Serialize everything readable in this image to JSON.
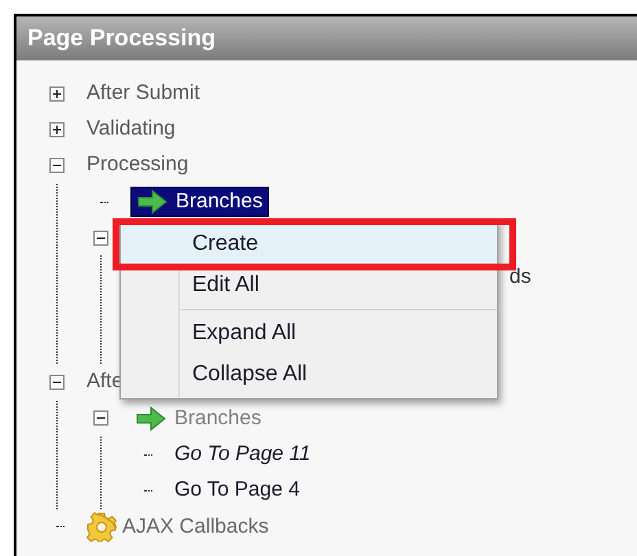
{
  "panel": {
    "title": "Page Processing"
  },
  "tree": [
    {
      "label": "After Submit",
      "expanded": false
    },
    {
      "label": "Validating",
      "expanded": false
    },
    {
      "label": "Processing",
      "expanded": true,
      "children": [
        {
          "label": "Branches",
          "kind": "branch",
          "selected": true
        },
        {
          "expanded": true,
          "children": [
            {
              "label": "ds",
              "covered": true
            }
          ]
        }
      ]
    },
    {
      "label": "Afte",
      "expanded": true,
      "children": [
        {
          "label": "Branches",
          "kind": "branch",
          "selected": false,
          "expanded": true,
          "children": [
            {
              "label": "Go To Page 11",
              "italic": true
            },
            {
              "label": "Go To Page 4",
              "italic": false
            }
          ]
        }
      ]
    },
    {
      "label": "AJAX Callbacks",
      "kind": "callbacks"
    }
  ],
  "context_menu": {
    "items": [
      {
        "label": "Create",
        "selected": true,
        "highlighted": true
      },
      {
        "label": "Edit All",
        "selected": false,
        "highlighted": false
      },
      {
        "kind": "separator"
      },
      {
        "label": "Expand All",
        "selected": false,
        "highlighted": false
      },
      {
        "label": "Collapse All",
        "selected": false,
        "highlighted": false
      }
    ]
  }
}
